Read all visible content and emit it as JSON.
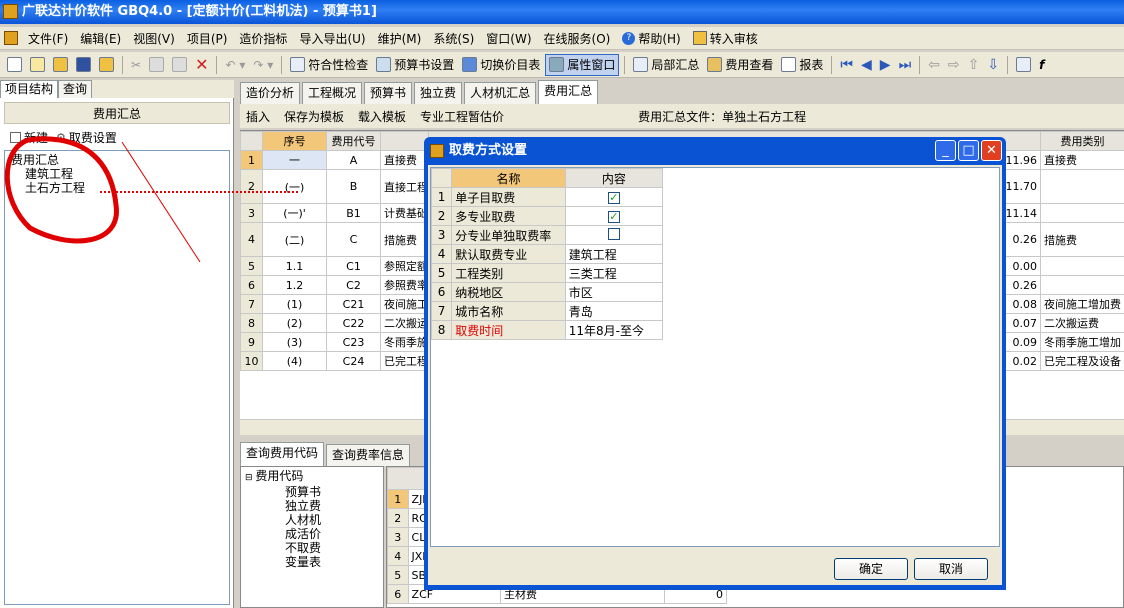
{
  "window": {
    "title": "广联达计价软件 GBQ4.0 - [定额计价(工料机法) - 预算书1]"
  },
  "menu": [
    "文件(F)",
    "编辑(E)",
    "视图(V)",
    "项目(P)",
    "造价指标",
    "导入导出(U)",
    "维护(M)",
    "系统(S)",
    "窗口(W)",
    "在线服务(O)",
    "帮助(H)",
    "转入审核"
  ],
  "toolbar": {
    "check": "符合性检查",
    "budget_set": "预算书设置",
    "switch_price": "切换价目表",
    "prop_window": "属性窗口",
    "local_sum": "局部汇总",
    "fee_view": "费用查看",
    "report": "报表"
  },
  "left": {
    "tabs": [
      "项目结构",
      "查询"
    ],
    "header": "费用汇总",
    "new_btn": "新建",
    "fee_settings_btn": "取费设置",
    "tree_root": "费用汇总",
    "tree_items": [
      "建筑工程",
      "土石方工程"
    ]
  },
  "main_tabs": [
    "造价分析",
    "工程概况",
    "预算书",
    "独立费",
    "人材机汇总",
    "费用汇总"
  ],
  "subbar": {
    "insert": "插入",
    "save_tpl": "保存为模板",
    "load_tpl": "载入模板",
    "pro_fee": "专业工程暂估价",
    "file_label": "费用汇总文件：单独土石方工程"
  },
  "grid": {
    "headers": [
      "序号",
      "费用代号",
      "",
      "",
      "费用类别"
    ],
    "rows": [
      {
        "n": "1",
        "seq": "一",
        "code": "A",
        "name": "直接费",
        "amt": "11.96",
        "cat": "直接费"
      },
      {
        "n": "2",
        "seq": "(一)",
        "code": "B",
        "name": "直接工程",
        "amt": "11.70",
        "cat": ""
      },
      {
        "n": "3",
        "seq": "(一)'",
        "code": "B1",
        "name": "计费基础",
        "amt": "11.14",
        "cat": ""
      },
      {
        "n": "4",
        "seq": "(二)",
        "code": "C",
        "name": "措施费",
        "amt": "0.26",
        "cat": "措施费"
      },
      {
        "n": "5",
        "seq": "1.1",
        "code": "C1",
        "name": "参照定额",
        "amt": "0.00",
        "cat": ""
      },
      {
        "n": "6",
        "seq": "1.2",
        "code": "C2",
        "name": "参照费率",
        "amt": "0.26",
        "cat": ""
      },
      {
        "n": "7",
        "seq": "(1)",
        "code": "C21",
        "name": "夜间施工",
        "amt": "0.08",
        "cat": "夜间施工增加费"
      },
      {
        "n": "8",
        "seq": "(2)",
        "code": "C22",
        "name": "二次搬运",
        "amt": "0.07",
        "cat": "二次搬运费"
      },
      {
        "n": "9",
        "seq": "(3)",
        "code": "C23",
        "name": "冬雨季施",
        "amt": "0.09",
        "cat": "冬雨季施工增加"
      },
      {
        "n": "10",
        "seq": "(4)",
        "code": "C24",
        "name": "已完工程",
        "amt": "0.02",
        "cat": "已完工程及设备"
      }
    ]
  },
  "bottom": {
    "tabs": [
      "查询费用代码",
      "查询费率信息"
    ],
    "tree_root": "费用代码",
    "tree_items": [
      "预算书",
      "独立费",
      "人材机",
      "成活价",
      "不取费",
      "变量表"
    ],
    "codes": [
      {
        "n": "1",
        "code": "ZJF"
      },
      {
        "n": "2",
        "code": "RGF"
      },
      {
        "n": "3",
        "code": "CLF"
      },
      {
        "n": "4",
        "code": "JXF"
      },
      {
        "n": "5",
        "code": "SBF"
      },
      {
        "n": "6",
        "code": "ZCF"
      }
    ],
    "row6_name": "主材费",
    "row6_val": "0"
  },
  "dialog": {
    "title": "取费方式设置",
    "col_name": "名称",
    "col_content": "内容",
    "rows": [
      {
        "n": "1",
        "name": "单子目取费",
        "value": "",
        "checked": true
      },
      {
        "n": "2",
        "name": "多专业取费",
        "value": "",
        "checked": true
      },
      {
        "n": "3",
        "name": "分专业单独取费率",
        "value": "",
        "checked": false
      },
      {
        "n": "4",
        "name": "默认取费专业",
        "value": "建筑工程"
      },
      {
        "n": "5",
        "name": "工程类别",
        "value": "三类工程"
      },
      {
        "n": "6",
        "name": "纳税地区",
        "value": "市区"
      },
      {
        "n": "7",
        "name": "城市名称",
        "value": "青岛"
      },
      {
        "n": "8",
        "name": "取费时间",
        "value": "11年8月-至今"
      }
    ],
    "ok": "确定",
    "cancel": "取消"
  },
  "colors": {
    "title_blue": "#0a54d4",
    "highlight_red": "#e00000",
    "selected_orange": "#f2c77a"
  }
}
